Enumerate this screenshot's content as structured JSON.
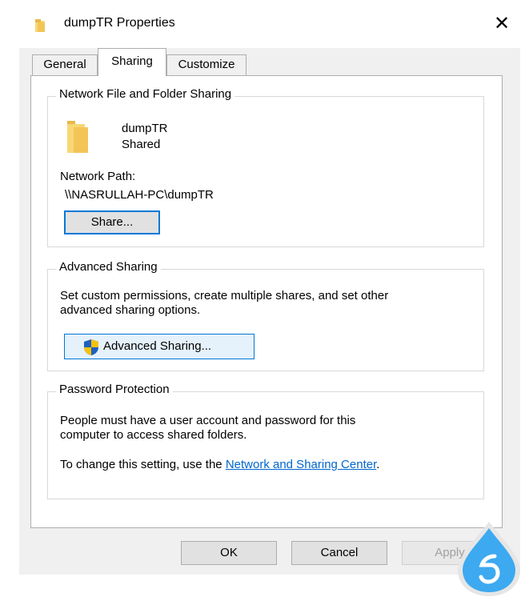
{
  "window": {
    "title": "dumpTR Properties",
    "close_glyph": "✕"
  },
  "tabs": [
    {
      "label": "General",
      "active": false
    },
    {
      "label": "Sharing",
      "active": true
    },
    {
      "label": "Customize",
      "active": false
    }
  ],
  "network_sharing": {
    "legend": "Network File and Folder Sharing",
    "folder_name": "dumpTR",
    "status": "Shared",
    "path_label": "Network Path:",
    "path_value": "\\\\NASRULLAH-PC\\dumpTR",
    "share_button": "Share..."
  },
  "advanced_sharing": {
    "legend": "Advanced Sharing",
    "description_line1": "Set custom permissions, create multiple shares, and set other",
    "description_line2": "advanced sharing options.",
    "button_label": "Advanced Sharing..."
  },
  "password_protection": {
    "legend": "Password Protection",
    "text_line1": "People must have a user account and password for this",
    "text_line2": "computer to access shared folders.",
    "change_prefix": "To change this setting, use the ",
    "link_text": "Network and Sharing Center",
    "change_suffix": "."
  },
  "footer": {
    "ok": "OK",
    "cancel": "Cancel",
    "apply": "Apply"
  },
  "colors": {
    "accent": "#0078d7",
    "link": "#0066cc",
    "folder": "#f8d775",
    "watermark": "#3da9f0"
  }
}
